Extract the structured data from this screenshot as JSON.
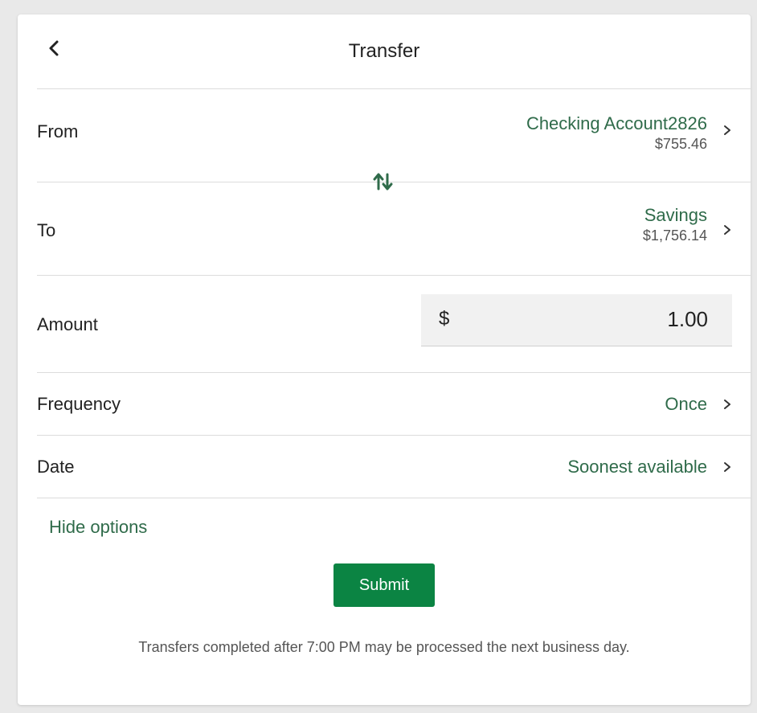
{
  "header": {
    "title": "Transfer"
  },
  "from": {
    "label": "From",
    "account_name": "Checking Account2826",
    "balance": "$755.46"
  },
  "to": {
    "label": "To",
    "account_name": "Savings",
    "balance": "$1,756.14"
  },
  "amount": {
    "label": "Amount",
    "currency_symbol": "$",
    "value": "1.00"
  },
  "frequency": {
    "label": "Frequency",
    "value": "Once"
  },
  "date": {
    "label": "Date",
    "value": "Soonest available"
  },
  "options": {
    "hide_label": "Hide options"
  },
  "actions": {
    "submit_label": "Submit"
  },
  "footer": {
    "disclaimer": "Transfers completed after 7:00 PM may be processed the next business day."
  },
  "colors": {
    "accent": "#2f6b4a",
    "primary_button": "#0b8443"
  },
  "icons": {
    "back": "chevron-left-icon",
    "swap": "swap-icon",
    "row_chevron": "chevron-right-icon"
  }
}
